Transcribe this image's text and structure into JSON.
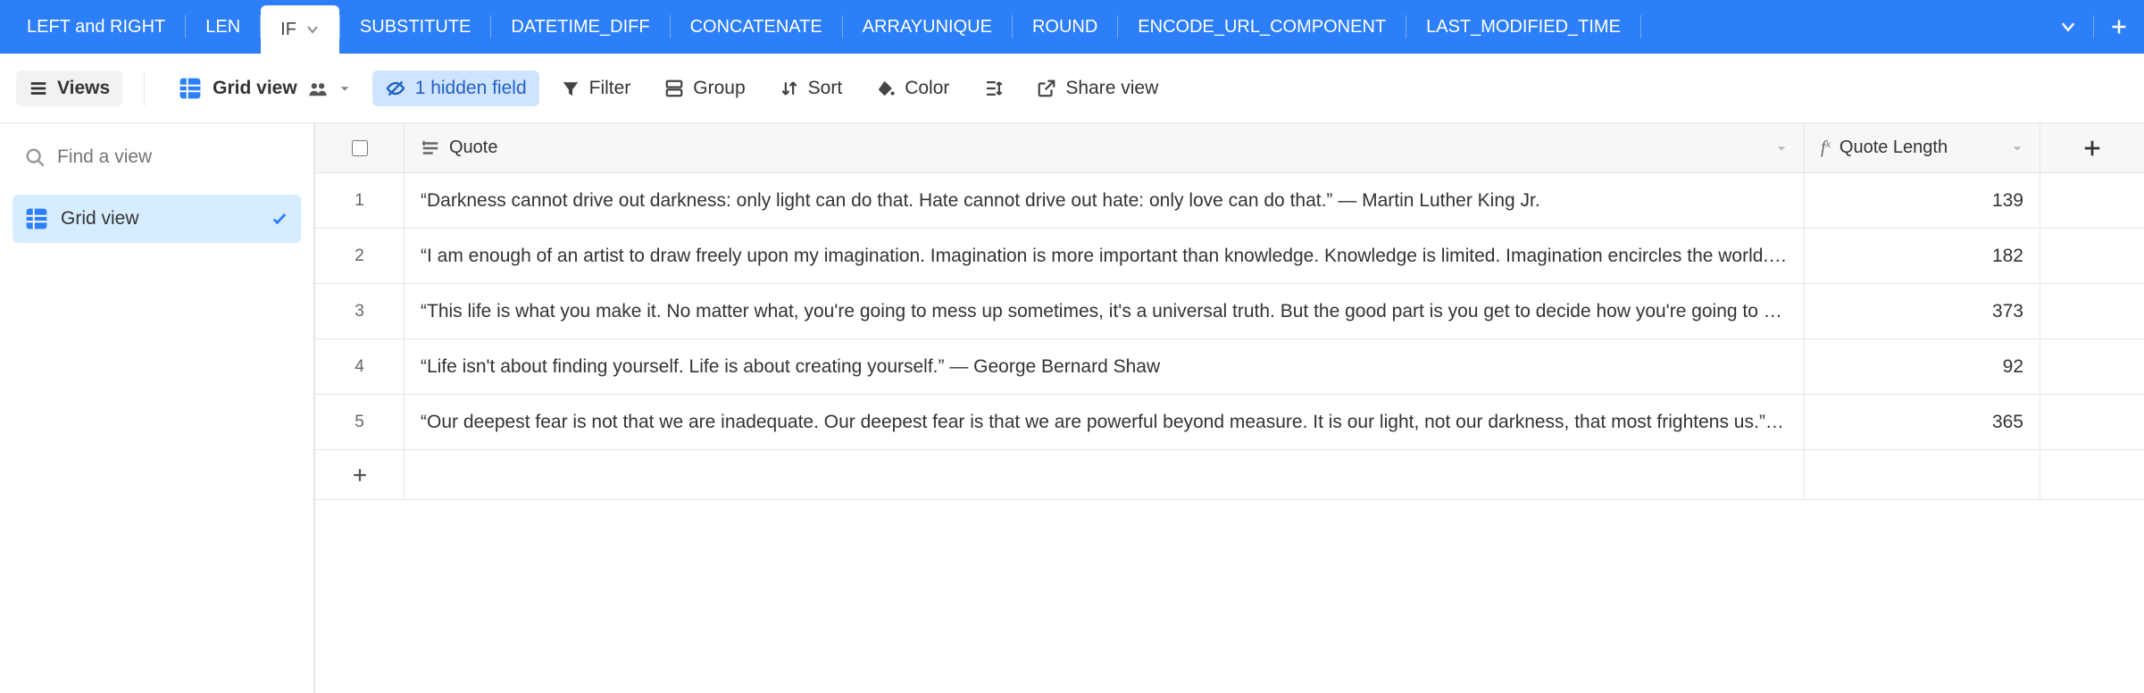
{
  "tabs": [
    {
      "label": "LEFT and RIGHT",
      "active": false
    },
    {
      "label": "LEN",
      "active": false
    },
    {
      "label": "IF",
      "active": true
    },
    {
      "label": "SUBSTITUTE",
      "active": false
    },
    {
      "label": "DATETIME_DIFF",
      "active": false
    },
    {
      "label": "CONCATENATE",
      "active": false
    },
    {
      "label": "ARRAYUNIQUE",
      "active": false
    },
    {
      "label": "ROUND",
      "active": false
    },
    {
      "label": "ENCODE_URL_COMPONENT",
      "active": false
    },
    {
      "label": "LAST_MODIFIED_TIME",
      "active": false
    }
  ],
  "toolbar": {
    "views_label": "Views",
    "view_name": "Grid view",
    "hidden_fields_label": "1 hidden field",
    "filter_label": "Filter",
    "group_label": "Group",
    "sort_label": "Sort",
    "color_label": "Color",
    "share_label": "Share view"
  },
  "sidebar": {
    "find_placeholder": "Find a view",
    "items": [
      {
        "label": "Grid view",
        "active": true
      }
    ]
  },
  "columns": {
    "quote_header": "Quote",
    "length_header": "Quote Length"
  },
  "rows": [
    {
      "n": "1",
      "quote": "“Darkness cannot drive out darkness: only light can do that. Hate cannot drive out hate: only love can do that.” — Martin Luther King Jr.",
      "len": "139"
    },
    {
      "n": "2",
      "quote": "“I am enough of an artist to draw freely upon my imagination. Imagination is more important than knowledge. Knowledge is limited. Imagination encircles the world.” — Albert Einstein",
      "len": "182"
    },
    {
      "n": "3",
      "quote": "“This life is what you make it. No matter what, you're going to mess up sometimes, it's a universal truth. But the good part is you get to decide how you're going to mess it up.” — Marilyn Monroe",
      "len": "373"
    },
    {
      "n": "4",
      "quote": "“Life isn't about finding yourself. Life is about creating yourself.” — George Bernard Shaw",
      "len": "92"
    },
    {
      "n": "5",
      "quote": "“Our deepest fear is not that we are inadequate. Our deepest fear is that we are powerful beyond measure. It is our light, not our darkness, that most frightens us.” — Marianne Williamson",
      "len": "365"
    }
  ]
}
